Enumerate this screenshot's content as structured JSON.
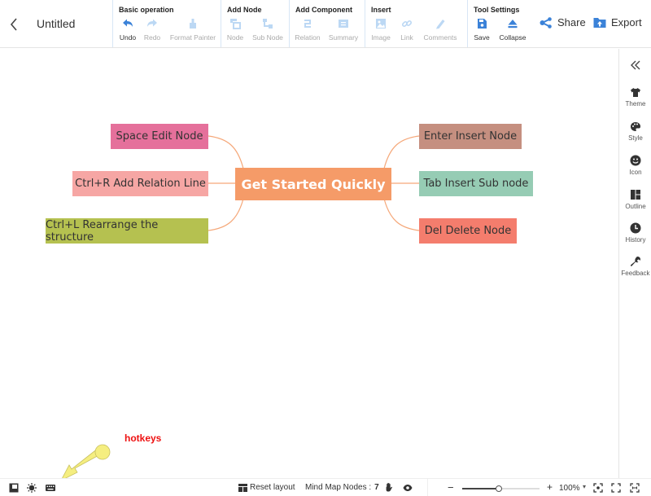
{
  "header": {
    "title": "Untitled",
    "groups": [
      {
        "title": "Basic operation",
        "tools": [
          {
            "label": "Undo",
            "icon": "undo-icon",
            "active": true
          },
          {
            "label": "Redo",
            "icon": "redo-icon",
            "active": false
          },
          {
            "label": "Format Painter",
            "icon": "format-painter-icon",
            "active": false
          }
        ]
      },
      {
        "title": "Add Node",
        "tools": [
          {
            "label": "Node",
            "icon": "node-icon",
            "active": false
          },
          {
            "label": "Sub Node",
            "icon": "sub-node-icon",
            "active": false
          }
        ]
      },
      {
        "title": "Add Component",
        "tools": [
          {
            "label": "Relation",
            "icon": "relation-icon",
            "active": false
          },
          {
            "label": "Summary",
            "icon": "summary-icon",
            "active": false
          }
        ]
      },
      {
        "title": "Insert",
        "tools": [
          {
            "label": "Image",
            "icon": "image-icon",
            "active": false
          },
          {
            "label": "Link",
            "icon": "link-icon",
            "active": false
          },
          {
            "label": "Comments",
            "icon": "comments-icon",
            "active": false
          }
        ]
      },
      {
        "title": "Tool Settings",
        "tools": [
          {
            "label": "Save",
            "icon": "save-icon",
            "active": true
          },
          {
            "label": "Collapse",
            "icon": "collapse-icon",
            "active": true
          }
        ]
      }
    ],
    "share_label": "Share",
    "export_label": "Export"
  },
  "sidebar": {
    "items": [
      {
        "label": "Theme",
        "icon": "shirt-icon"
      },
      {
        "label": "Style",
        "icon": "palette-icon"
      },
      {
        "label": "Icon",
        "icon": "smiley-icon"
      },
      {
        "label": "Outline",
        "icon": "outline-icon"
      },
      {
        "label": "History",
        "icon": "clock-icon"
      },
      {
        "label": "Feedback",
        "icon": "wrench-icon"
      }
    ]
  },
  "mindmap": {
    "root": {
      "label": "Get Started Quickly",
      "color": "#f59b68"
    },
    "left": [
      {
        "label": "Space Edit Node",
        "color": "#e5709b"
      },
      {
        "label": "Ctrl+R Add Relation Line",
        "color": "#f6a6a4"
      },
      {
        "label": "Ctrl+L Rearrange the structure",
        "color": "#b5c150"
      }
    ],
    "right": [
      {
        "label": "Enter Insert Node",
        "color": "#c58f80"
      },
      {
        "label": "Tab Insert Sub node",
        "color": "#96ccb4"
      },
      {
        "label": "Del Delete Node",
        "color": "#f47d6d"
      }
    ],
    "line_color": "#f5a87a"
  },
  "annotation": {
    "label": "hotkeys"
  },
  "footer": {
    "reset_layout": "Reset layout",
    "node_count_label": "Mind Map Nodes :",
    "node_count": "7",
    "zoom_level": "100%",
    "zoom_minus": "−",
    "zoom_plus": "+",
    "zoom_caret": "▾",
    "zoom_slider_fraction": 0.47
  }
}
